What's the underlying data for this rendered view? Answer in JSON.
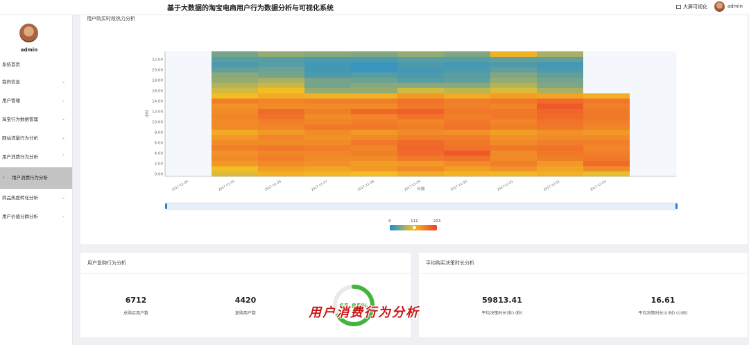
{
  "app": {
    "title": "基于大数据的淘宝电商用户行为数据分析与可视化系统",
    "screen_link": "大屏可视化",
    "user": "admin"
  },
  "sidebar": {
    "user": "admin",
    "items": [
      {
        "label": "系统首页",
        "chevron": ""
      },
      {
        "label": "我的信息",
        "chevron": "⌄"
      },
      {
        "label": "用户管理",
        "chevron": "⌄"
      },
      {
        "label": "淘宝行为数据管理",
        "chevron": "⌄"
      },
      {
        "label": "网站流量行为分析",
        "chevron": "⌄"
      },
      {
        "label": "用户消费行为分析",
        "chevron": "⌃"
      },
      {
        "label": "用户消费行为分析",
        "chevron": "",
        "sub": true,
        "active": true
      },
      {
        "label": "商品热度转化分析",
        "chevron": "⌄"
      },
      {
        "label": "用户价值分群分析",
        "chevron": "⌄"
      }
    ]
  },
  "heat_card": {
    "title": "用户购买时段热力分析"
  },
  "repeat_card": {
    "title": "用户复购行为分析",
    "stats": [
      {
        "value": "6712",
        "label": "总购买用户数"
      },
      {
        "value": "4420",
        "label": "复购用户数"
      }
    ],
    "rate": {
      "value": "65.85%",
      "fraction": 0.6585
    }
  },
  "decision_card": {
    "title": "平均购买决策时长分析",
    "stats": [
      {
        "value": "59813.41",
        "label": "平均决策时长(秒) (秒)"
      },
      {
        "value": "16.61",
        "label": "平均决策时长(小时) (小时)"
      }
    ]
  },
  "watermark": "用户消费行为分析",
  "colors": {
    "low": "#1a8ed6",
    "mid": "#f3c224",
    "high": "#ef3b2c",
    "accent_green": "#43b53e",
    "empty_cell": "#f4f7fc"
  },
  "chart_data": {
    "type": "heatmap",
    "title": "",
    "xlabel": "日期",
    "ylabel": "小时",
    "x": [
      "2017-11-24",
      "2017-11-25",
      "2017-11-26",
      "2017-11-27",
      "2017-11-28",
      "2017-11-29",
      "2017-11-30",
      "2017-12-01",
      "2017-12-02",
      "2017-12-03"
    ],
    "y_ticks": [
      "0:00",
      "2:00",
      "4:00",
      "6:00",
      "8:00",
      "10:00",
      "12:00",
      "14:00",
      "16:00",
      "18:00",
      "20:00",
      "22:00"
    ],
    "y": [
      0,
      1,
      2,
      3,
      4,
      5,
      6,
      7,
      8,
      9,
      10,
      11,
      12,
      13,
      14,
      15,
      16,
      17,
      18,
      19,
      20,
      21,
      22,
      23
    ],
    "visual_map": {
      "min": 0,
      "max": 213,
      "handle": 111,
      "min_label": "0",
      "handle_label": "111",
      "max_label": "213"
    },
    "grid": false,
    "data_zoom": true,
    "values": [
      [
        null,
        95,
        120,
        115,
        110,
        125,
        118,
        115,
        120,
        100,
        null
      ],
      [
        null,
        110,
        135,
        130,
        140,
        150,
        135,
        145,
        130,
        150,
        null
      ],
      [
        null,
        140,
        150,
        145,
        135,
        140,
        150,
        160,
        140,
        175,
        null
      ],
      [
        null,
        150,
        160,
        150,
        150,
        165,
        170,
        150,
        160,
        165,
        null
      ],
      [
        null,
        145,
        155,
        155,
        160,
        175,
        190,
        150,
        165,
        160,
        null
      ],
      [
        null,
        160,
        165,
        160,
        155,
        180,
        170,
        165,
        170,
        155,
        null
      ],
      [
        null,
        150,
        150,
        150,
        165,
        175,
        165,
        150,
        160,
        160,
        null
      ],
      [
        null,
        140,
        155,
        145,
        150,
        160,
        160,
        145,
        150,
        150,
        null
      ],
      [
        null,
        125,
        140,
        150,
        140,
        150,
        145,
        135,
        145,
        140,
        null
      ],
      [
        null,
        150,
        155,
        165,
        165,
        160,
        170,
        160,
        165,
        155,
        null
      ],
      [
        null,
        150,
        160,
        155,
        160,
        155,
        165,
        155,
        170,
        160,
        null
      ],
      [
        null,
        155,
        170,
        150,
        155,
        170,
        160,
        165,
        175,
        165,
        null
      ],
      [
        null,
        150,
        175,
        160,
        180,
        185,
        165,
        165,
        180,
        165,
        null
      ],
      [
        null,
        145,
        150,
        150,
        150,
        165,
        160,
        155,
        190,
        160,
        null
      ],
      [
        null,
        160,
        155,
        160,
        160,
        170,
        160,
        165,
        175,
        165,
        null
      ],
      [
        null,
        110,
        125,
        120,
        120,
        140,
        125,
        135,
        130,
        120,
        null
      ],
      [
        null,
        90,
        110,
        60,
        60,
        90,
        80,
        95,
        70,
        null,
        null
      ],
      [
        null,
        75,
        85,
        45,
        55,
        55,
        55,
        75,
        50,
        null,
        null
      ],
      [
        null,
        60,
        70,
        45,
        40,
        30,
        35,
        60,
        45,
        null,
        null
      ],
      [
        null,
        55,
        45,
        25,
        30,
        25,
        30,
        50,
        35,
        null,
        null
      ],
      [
        null,
        35,
        40,
        20,
        15,
        20,
        25,
        35,
        25,
        null,
        null
      ],
      [
        null,
        25,
        30,
        20,
        15,
        25,
        20,
        25,
        20,
        null,
        null
      ],
      [
        null,
        30,
        30,
        25,
        25,
        30,
        30,
        35,
        35,
        null,
        null
      ],
      [
        null,
        45,
        60,
        55,
        50,
        60,
        50,
        120,
        70,
        null,
        null
      ]
    ]
  }
}
